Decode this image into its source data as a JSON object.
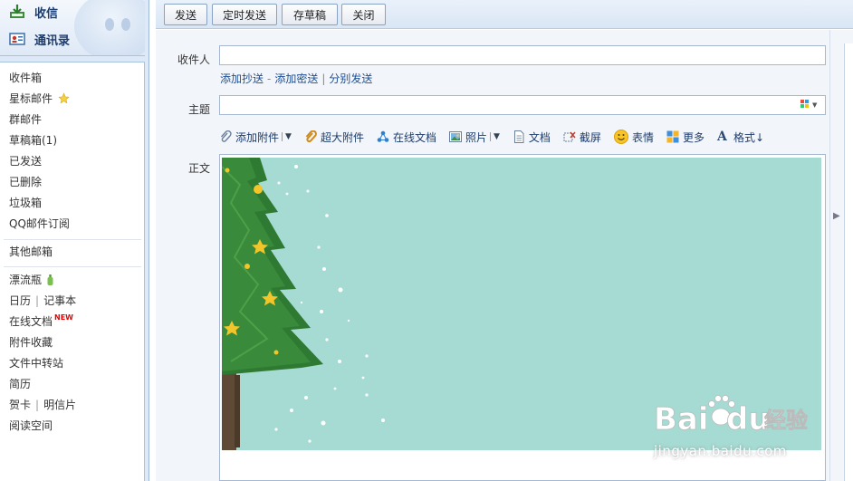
{
  "sidebar": {
    "top": [
      {
        "label": "收信",
        "icon": "inbox-download-icon"
      },
      {
        "label": "通讯录",
        "icon": "contacts-card-icon"
      }
    ],
    "folders": [
      {
        "label": "收件箱"
      },
      {
        "label": "星标邮件"
      },
      {
        "label": "群邮件"
      },
      {
        "label": "草稿箱(1)"
      },
      {
        "label": "已发送"
      },
      {
        "label": "已删除"
      },
      {
        "label": "垃圾箱"
      },
      {
        "label": "QQ邮件订阅"
      }
    ],
    "other_mailbox": "其他邮箱",
    "apps": {
      "drift_bottle": "漂流瓶",
      "calendar": "日历",
      "notes": "记事本",
      "online_docs": "在线文档",
      "new_badge": "NEW",
      "attachment_collection": "附件收藏",
      "file_transfer": "文件中转站",
      "resume": "简历",
      "greeting_card": "贺卡",
      "postcard": "明信片",
      "reading_space": "阅读空间"
    }
  },
  "toolbar": {
    "send": "发送",
    "scheduled_send": "定时发送",
    "save_draft": "存草稿",
    "close": "关闭"
  },
  "compose": {
    "recipient_label": "收件人",
    "recipient_value": "",
    "add_cc": "添加抄送",
    "dash": "-",
    "add_bcc": "添加密送",
    "pipe": "|",
    "separate_send": "分别发送",
    "subject_label": "主题",
    "subject_value": "",
    "body_label": "正文",
    "attachments": {
      "add_attachment": "添加附件",
      "large_attachment": "超大附件",
      "online_doc": "在线文档",
      "photo": "照片",
      "document": "文档",
      "screenshot": "截屏",
      "emoji": "表情",
      "more": "更多",
      "format": "格式↓"
    }
  },
  "colors": {
    "sidebar_bg": "#dde9f7",
    "toolbar_bg": "#d9e6f5",
    "link": "#1d4f95",
    "card_bg": "#a6dbd3",
    "tree_green": "#2f7a32",
    "star_gold": "#f2c52a"
  },
  "watermark": {
    "brand": "Bai",
    "brand_cn": "经验",
    "url": "jingyan.baidu.com"
  }
}
